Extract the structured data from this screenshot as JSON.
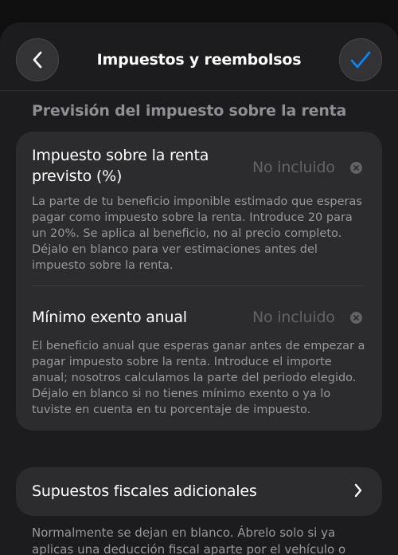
{
  "header": {
    "title": "Impuestos y reembolsos",
    "back_icon": "chevron-left-icon",
    "confirm_icon": "checkmark-icon",
    "accent_color": "#0a84ff"
  },
  "section": {
    "title": "Previsión del impuesto sobre la renta"
  },
  "income_tax": {
    "label_line1": "Impuesto sobre la renta",
    "label_line2": "previsto (%)",
    "value_placeholder": "No incluido",
    "description": "La parte de tu beneficio imponible estimado que esperas pagar como impuesto sobre la renta. Introduce 20 para un 20%. Se aplica al beneficio, no al precio completo. Déjalo en blanco para ver estimaciones antes del impuesto sobre la renta."
  },
  "annual_allowance": {
    "label": "Mínimo exento anual",
    "value_placeholder": "No incluido",
    "description": "El beneficio anual que esperas ganar antes de empezar a pagar impuesto sobre la renta. Introduce el importe anual; nosotros calculamos la parte del periodo elegido. Déjalo en blanco si no tienes mínimo exento o ya lo tuviste en cuenta en tu porcentaje de impuesto."
  },
  "additional": {
    "label": "Supuestos fiscales adicionales",
    "chevron_icon": "chevron-right-icon"
  },
  "footer": {
    "text": "Normalmente se dejan en blanco. Ábrelo solo si ya aplicas una deducción fiscal aparte por el vehículo o"
  }
}
